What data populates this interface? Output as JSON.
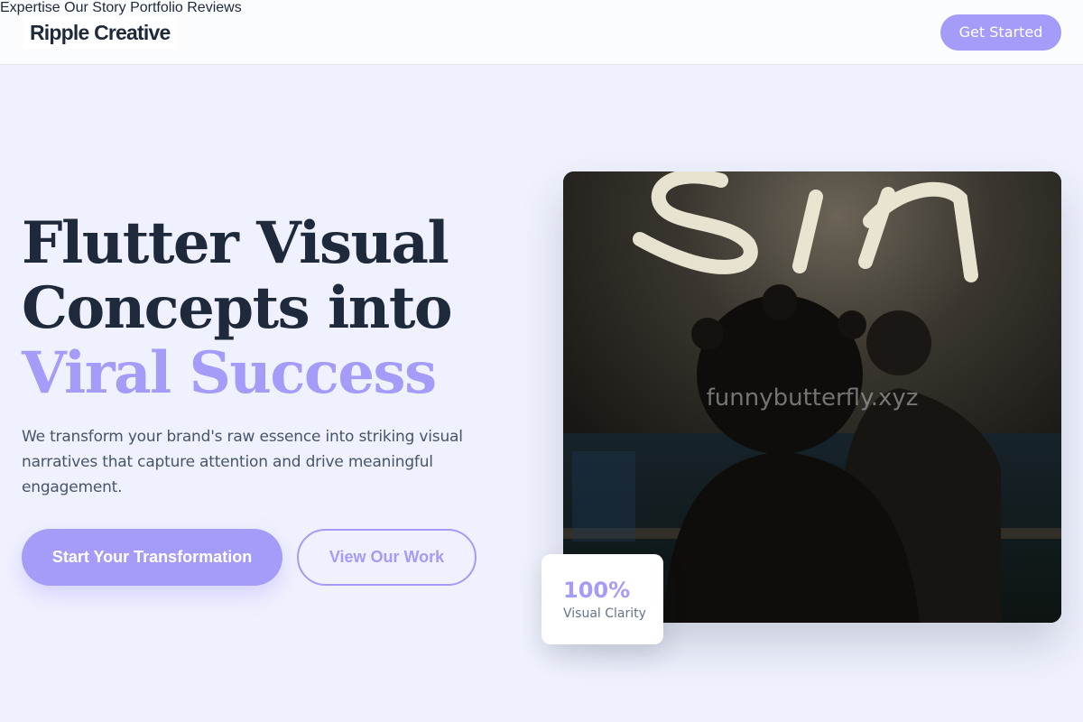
{
  "brand": {
    "name": "Ripple Creative"
  },
  "nav": {
    "items": [
      {
        "label": "Expertise"
      },
      {
        "label": "Our Story"
      },
      {
        "label": "Portfolio"
      },
      {
        "label": "Reviews"
      }
    ],
    "cta_label": "Get Started"
  },
  "hero": {
    "headline_line1": "Flutter Visual",
    "headline_line2": "Concepts into",
    "headline_accent": "Viral Success",
    "description": "We transform your brand's raw essence into striking visual narratives that capture attention and drive meaningful engagement.",
    "primary_button": "Start Your Transformation",
    "secondary_button": "View Our Work"
  },
  "image": {
    "watermark": "funnybutterfly.xyz",
    "neon_sign_text": "sin"
  },
  "stat": {
    "value": "100%",
    "label": "Visual Clarity"
  },
  "colors": {
    "accent": "#a59bf8",
    "heading": "#1e293b",
    "background": "#eff1fe"
  }
}
